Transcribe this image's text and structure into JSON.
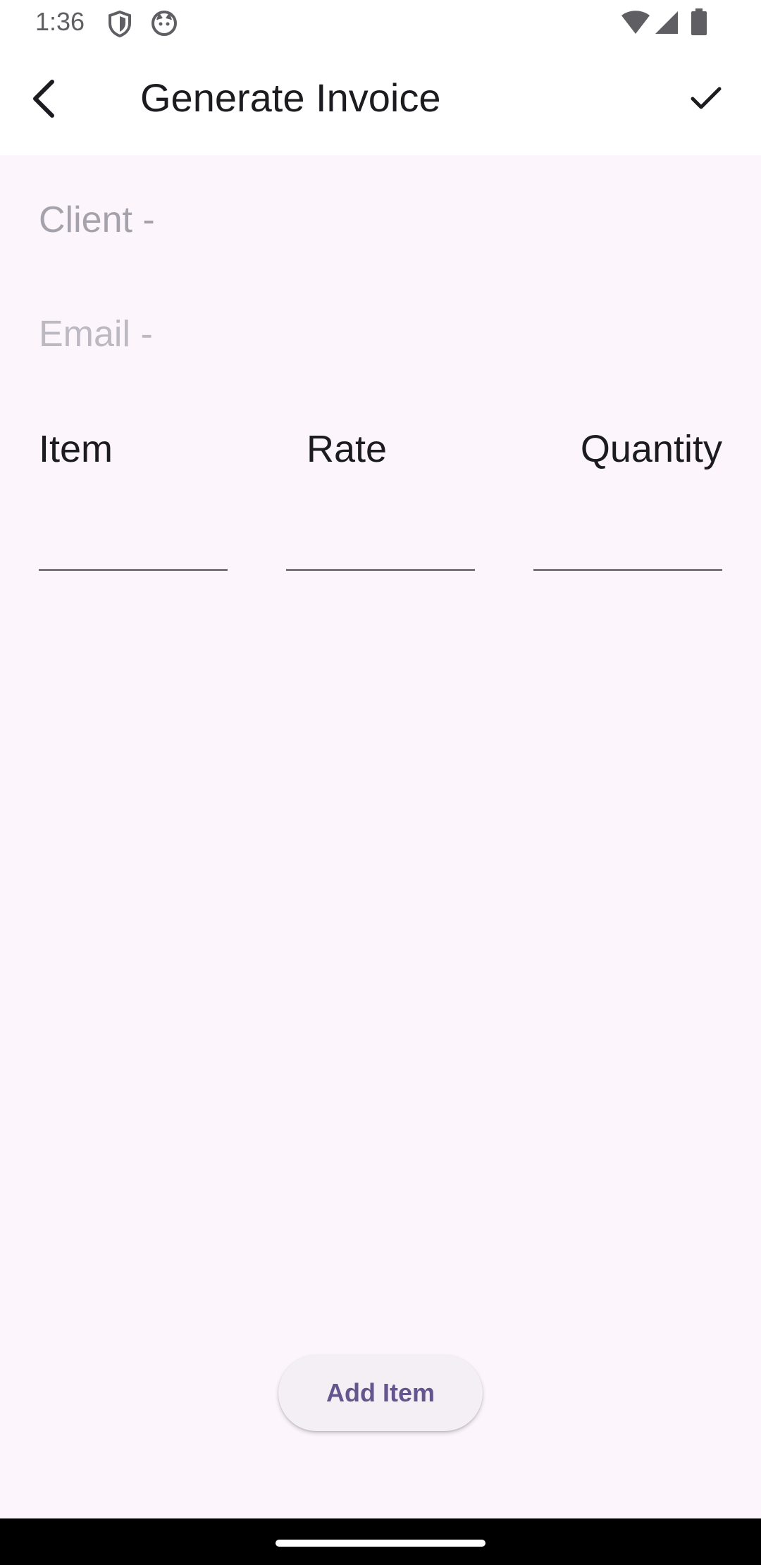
{
  "status_bar": {
    "time": "1:36",
    "icons": [
      "shield-icon",
      "cat-face-icon",
      "wifi-icon",
      "signal-icon",
      "battery-icon"
    ]
  },
  "app_bar": {
    "title": "Generate Invoice",
    "back_icon": "back-arrow-icon",
    "confirm_icon": "check-icon"
  },
  "form": {
    "client_label": "Client -",
    "email_label": "Email -"
  },
  "table": {
    "columns": [
      "Item",
      "Rate",
      "Quantity"
    ],
    "row": {
      "item_value": "",
      "rate_value": "",
      "quantity_value": ""
    }
  },
  "actions": {
    "add_item_label": "Add Item"
  },
  "colors": {
    "background": "#fcf5fc",
    "accent": "#65558f",
    "hint_text": "#a6a2ab"
  }
}
